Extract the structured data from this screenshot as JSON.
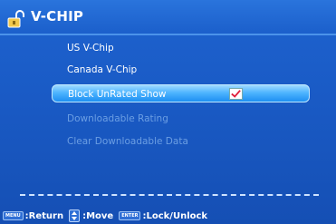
{
  "header": {
    "title": "V-CHIP",
    "icon": "unlocked-padlock-icon"
  },
  "menu": {
    "items": [
      {
        "label": "US V-Chip",
        "state": "enabled"
      },
      {
        "label": "Canada V-Chip",
        "state": "enabled"
      },
      {
        "label": "Block UnRated Show",
        "state": "selected",
        "checked": true
      },
      {
        "label": "Downloadable Rating",
        "state": "disabled"
      },
      {
        "label": "Clear Downloadable Data",
        "state": "disabled"
      }
    ]
  },
  "footer": {
    "return_key": "MENU",
    "return_label": ":Return",
    "move_label": ":Move",
    "enter_key": "ENTER",
    "lock_label": ":Lock/Unlock"
  },
  "colors": {
    "background": "#1a5bc6",
    "highlight": "#4fb5ff",
    "disabled_text": "#6b9ee3",
    "check": "#e0203c"
  }
}
